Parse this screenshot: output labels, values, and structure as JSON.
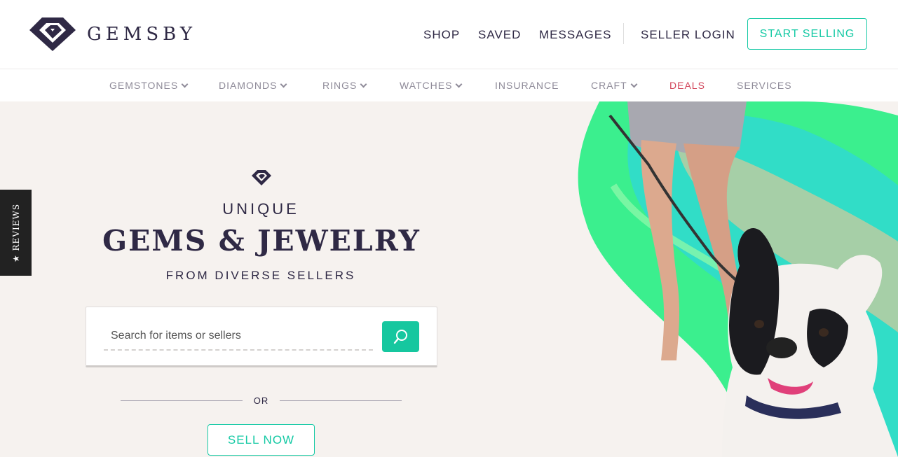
{
  "brand": {
    "name": "GEMSBY",
    "logo_icon": "gemsby-diamond-logo",
    "color": "#2f2945"
  },
  "header": {
    "nav": {
      "shop": "SHOP",
      "saved": "SAVED",
      "messages": "MESSAGES",
      "seller_login": "SELLER LOGIN"
    },
    "cta": "START SELLING"
  },
  "categories": [
    {
      "label": "GEMSTONES",
      "dropdown": true
    },
    {
      "label": "DIAMONDS",
      "dropdown": true
    },
    {
      "label": "RINGS",
      "dropdown": true
    },
    {
      "label": "WATCHES",
      "dropdown": true
    },
    {
      "label": "INSURANCE",
      "dropdown": false
    },
    {
      "label": "CRAFT",
      "dropdown": true
    },
    {
      "label": "DEALS",
      "dropdown": false,
      "highlight": "#d2465b"
    },
    {
      "label": "SERVICES",
      "dropdown": false
    }
  ],
  "reviews_tab": {
    "label": "★ REVIEWS"
  },
  "hero": {
    "kicker": "UNIQUE",
    "title": "GEMS & JEWELRY",
    "subtitle": "FROM DIVERSE SELLERS",
    "search": {
      "placeholder": "Search for items or sellers",
      "button_icon": "search-icon"
    },
    "or_text": "OR",
    "sell_button": "SELL NOW"
  },
  "colors": {
    "accent": "#14c9a4",
    "hero_bg": "#f6f2ef",
    "deals": "#d2465b"
  }
}
